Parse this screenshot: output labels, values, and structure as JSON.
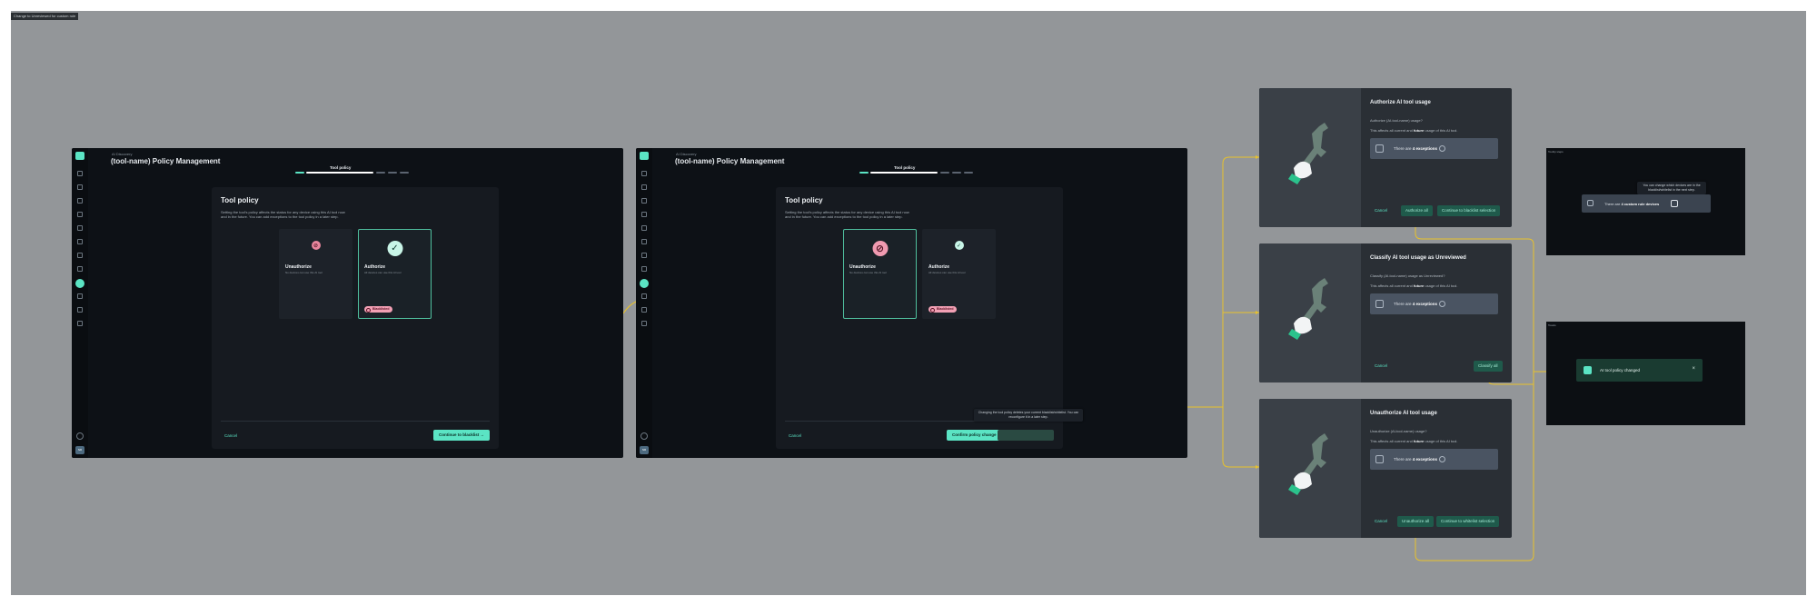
{
  "frame_label": "Change to Unreviewed for custom rule",
  "app": {
    "breadcrumb": "AI Discovery",
    "page_title": "(tool-name) Policy Management",
    "step_label": "Tool policy",
    "accent_color": "#5be4c4",
    "panel": {
      "title": "Tool policy",
      "description": "Setting the tool's policy affects the status for any device using this AI tool now and in the future. You can add exceptions to the tool policy in a later step."
    },
    "options": [
      {
        "title": "Unauthorize",
        "subtitle": "No devices can use this AI tool",
        "icon": "blocked-icon"
      },
      {
        "title": "Authorize",
        "subtitle": "All devices can use this AI tool",
        "icon": "check-icon",
        "badge": "Blacklisted"
      }
    ],
    "cancel_label": "Cancel",
    "screen1_primary": "Continue to blacklist",
    "screen2_confirm": "Confirm policy change",
    "screen2_tooltip": "Changing the tool policy deletes your current blacklist/whitelist. You can reconfigure it in a later step."
  },
  "modals": [
    {
      "title": "Authorize AI tool usage",
      "question": "Authorize (AI-tool-name) usage?",
      "effect_prefix": "This affects all current and ",
      "effect_bold": "future",
      "effect_suffix": " usage of this AI tool.",
      "exceptions_prefix": "There are ",
      "exceptions_bold": "4 exceptions",
      "cancel": "Cancel",
      "buttons": [
        "Authorize all",
        "Continue to blacklist selection"
      ]
    },
    {
      "title": "Classify AI tool usage as Unreviewed",
      "question": "Classify (AI-tool-name) usage as Unreviewed?",
      "effect_prefix": "This affects all current and ",
      "effect_bold": "future",
      "effect_suffix": " usage of this AI tool.",
      "exceptions_prefix": "There are ",
      "exceptions_bold": "4 exceptions",
      "cancel": "Cancel",
      "buttons": [
        "Classify all"
      ]
    },
    {
      "title": "Unauthorize AI tool usage",
      "question": "Unauthorize (AI-tool-name) usage?",
      "effect_prefix": "This affects all current and ",
      "effect_bold": "future",
      "effect_suffix": " usage of this AI tool.",
      "exceptions_prefix": "There are ",
      "exceptions_bold": "4 exceptions",
      "cancel": "Cancel",
      "buttons": [
        "Unauthorize all",
        "Continue to whitelist selection"
      ]
    }
  ],
  "tooltip_frame": {
    "name": "Tooltip steps",
    "tooltip": "You can change which devices are in the blacklist/whitelist in the next step.",
    "chip_prefix": "There are ",
    "chip_bold": "4 custom rule devices"
  },
  "toast_frame": {
    "name": "Toasts",
    "message": "AI tool policy changed"
  }
}
